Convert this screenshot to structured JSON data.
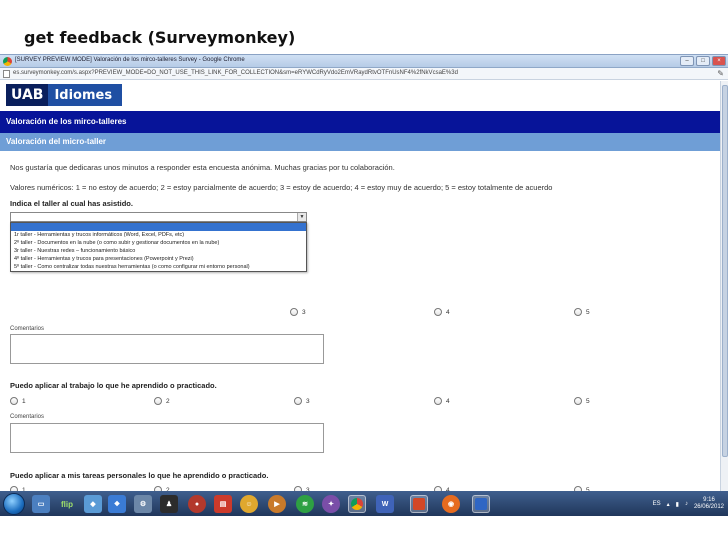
{
  "slide": {
    "title": "get feedback (Surveymonkey)"
  },
  "browser": {
    "window_title": "[SURVEY PREVIEW MODE] Valoración de los mirco-talleres Survey - Google Chrome",
    "url": "es.surveymonkey.com/s.aspx?PREVIEW_MODE=DO_NOT_USE_THIS_LINK_FOR_COLLECTION&sm=eRYWCdRyVdo2EmVRaydRtvOTFnUsNF4%2fNkVcsaE%3d"
  },
  "page": {
    "logo_primary": "UAB",
    "logo_secondary": "Idiomes",
    "survey_title": "Valoración de los mirco-talleres",
    "section_title": "Valoración del micro-taller",
    "intro": "Nos gustaría que dedicaras unos minutos a responder esta encuesta anónima. Muchas gracias por tu colaboración.",
    "scale": "Valores numéricos: 1 = no estoy de acuerdo; 2 = estoy parcialmente de acuerdo; 3 = estoy de acuerdo; 4 = estoy muy de acuerdo; 5 = estoy totalmente de acuerdo",
    "q1": {
      "title": "Indica el taller al cual has asistido.",
      "options": [
        "",
        "1r taller - Herramientas y trucos informáticos (Word, Excel, PDFs, etc)",
        "2º taller - Documentos en la nube (o como subir y gestionar documentos en la nube)",
        "3r taller - Nuestras redes – funcionamiento básico",
        "4º taller - Herramientas y trucos para presentaciones (Powerpoint y Prezi)",
        "5º taller - Como centralizar todas nuestras herramientas (o como configurar mi entorno personal)"
      ]
    },
    "q2": {
      "title": "Puedo aplicar al trabajo lo que he aprendido o practicado."
    },
    "q3": {
      "title": "Puedo aplicar a mis tareas personales lo que he aprendido o practicado."
    },
    "ratings": [
      "1",
      "2",
      "3",
      "4",
      "5"
    ],
    "comments_label": "Comentarios"
  },
  "taskbar": {
    "language": "ES",
    "time": "9:16",
    "date": "26/06/2012",
    "flip_label": "flip"
  },
  "colors": {
    "survey_header": "#071499",
    "section_header": "#6f9ed6",
    "logo_blue": "#1f4fa3"
  }
}
